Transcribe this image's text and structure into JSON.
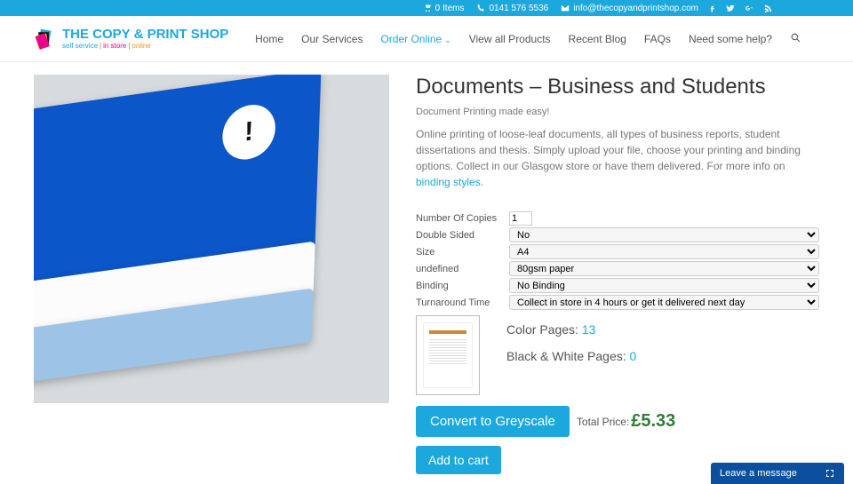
{
  "topbar": {
    "cart": "0 Items",
    "phone": "0141 576 5536",
    "email": "info@thecopyandprintshop.com"
  },
  "logo": {
    "main": "THE COPY & PRINT SHOP",
    "sub1": "self service",
    "sub2": "in store",
    "sub3": "online"
  },
  "nav": {
    "home": "Home",
    "services": "Our Services",
    "order": "Order Online",
    "products": "View all Products",
    "blog": "Recent Blog",
    "faqs": "FAQs",
    "help": "Need some help?"
  },
  "product": {
    "title": "Documents – Business and Students",
    "tagline": "Document Printing made easy!",
    "description": "Online printing of loose-leaf documents, all types of business reports, student dissertations and thesis. Simply upload your file, choose your printing and binding options. Collect in our Glasgow store or have them delivered. For more info on ",
    "link_text": "binding styles"
  },
  "options": {
    "copies_label": "Number Of Copies",
    "copies_value": "1",
    "double_label": "Double Sided",
    "double_value": "No",
    "size_label": "Size",
    "size_value": "A4",
    "undef_label": "undefined",
    "undef_value": "80gsm paper",
    "binding_label": "Binding",
    "binding_value": "No Binding",
    "turnaround_label": "Turnaround Time",
    "turnaround_value": "Collect in store in 4 hours or get it delivered next day"
  },
  "pages": {
    "color_label": "Color Pages: ",
    "color_value": "13",
    "bw_label": "Black & White Pages: ",
    "bw_value": "0"
  },
  "actions": {
    "greyscale": "Convert to Greyscale",
    "price_label": "Total Price: ",
    "price_value": "£5.33",
    "add_cart": "Add to cart"
  },
  "chat": {
    "label": "Leave a message"
  }
}
